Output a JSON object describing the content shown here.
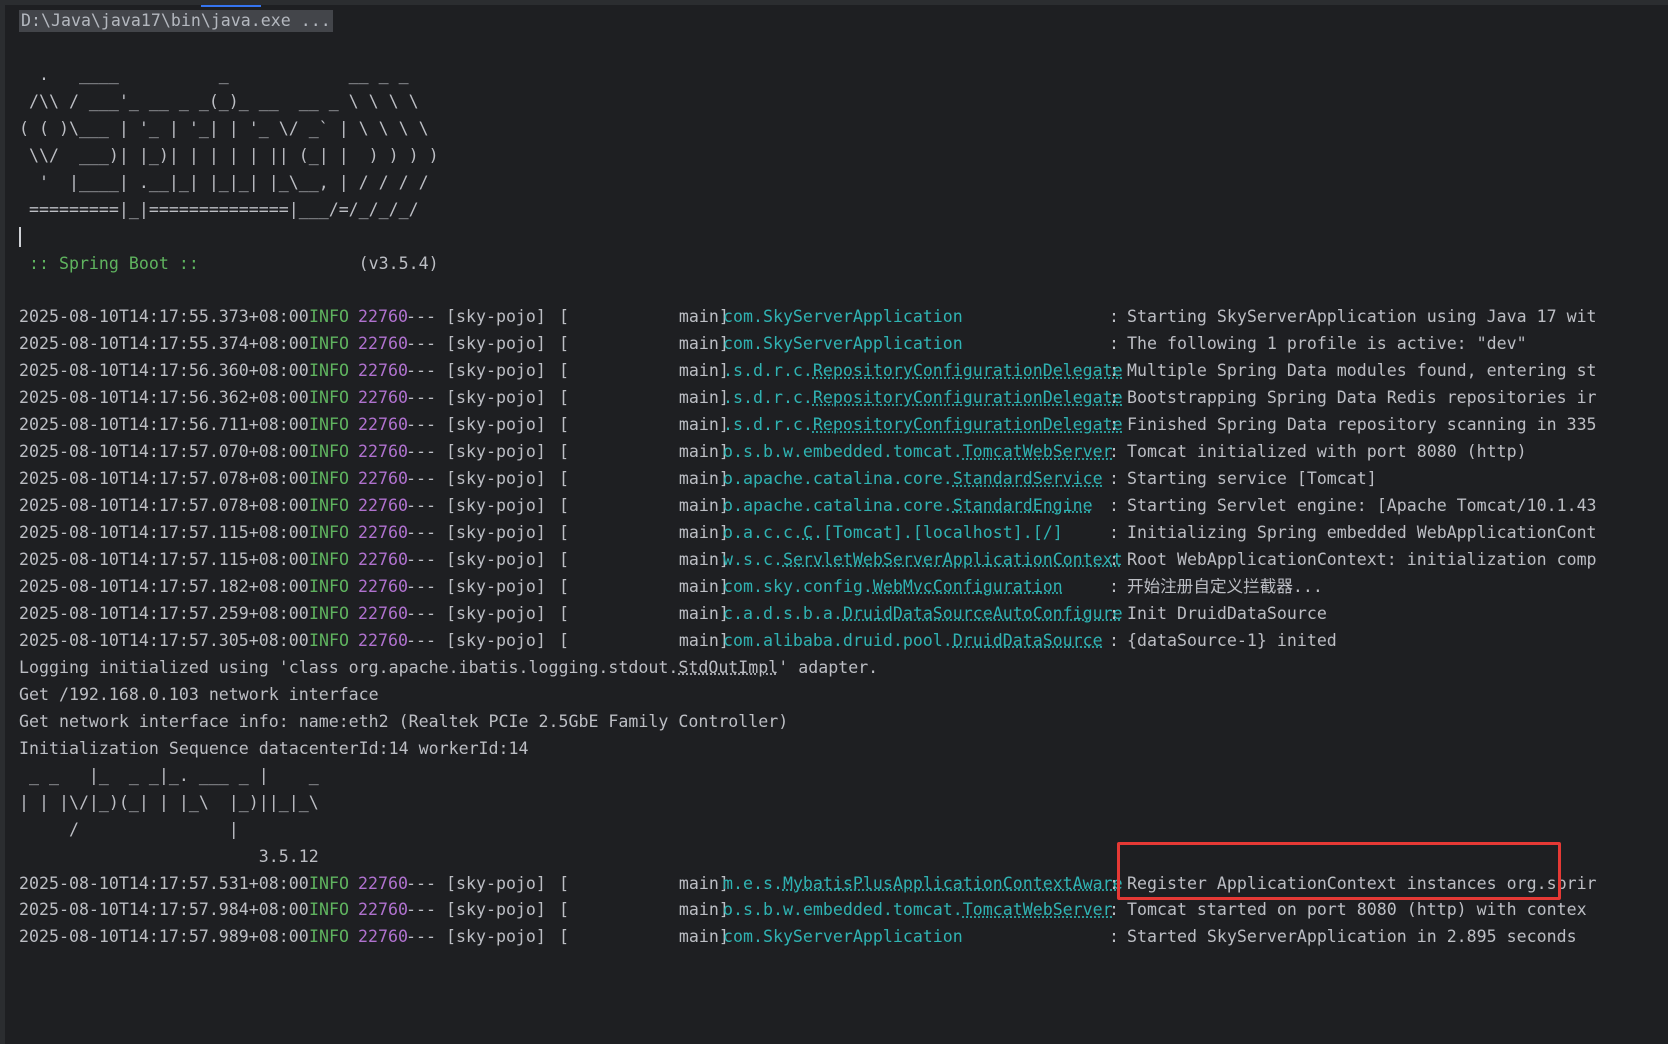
{
  "command_line": "D:\\Java\\java17\\bin\\java.exe ...",
  "banner_lines": [
    "  .   ____          _            __ _ _",
    " /\\\\ / ___'_ __ _ _(_)_ __  __ _ \\ \\ \\ \\",
    "( ( )\\___ | '_ | '_| | '_ \\/ _` | \\ \\ \\ \\",
    " \\\\/  ___)| |_)| | | | | || (_| |  ) ) ) )",
    "  '  |____| .__|_| |_|_| |_\\__, | / / / /",
    " =========|_|==============|___/=/_/_/_/"
  ],
  "spring_boot_label": " :: Spring Boot :: ",
  "spring_boot_version": "               (v3.5.4)",
  "log_entries_1": [
    {
      "ts": "2025-08-10T14:17:55.373+08:00",
      "level": "INFO",
      "pid": "22760",
      "sep": "---",
      "app": "[sky-pojo]",
      "thread": "[           main]",
      "logger_prefix": "com.SkyServerApplication",
      "logger_class": "",
      "message": "Starting SkyServerApplication using Java 17 wit"
    },
    {
      "ts": "2025-08-10T14:17:55.374+08:00",
      "level": "INFO",
      "pid": "22760",
      "sep": "---",
      "app": "[sky-pojo]",
      "thread": "[           main]",
      "logger_prefix": "com.SkyServerApplication",
      "logger_class": "",
      "message": "The following 1 profile is active: \"dev\""
    },
    {
      "ts": "2025-08-10T14:17:56.360+08:00",
      "level": "INFO",
      "pid": "22760",
      "sep": "---",
      "app": "[sky-pojo]",
      "thread": "[           main]",
      "logger_prefix": ".s.d.r.c.",
      "logger_class": "RepositoryConfigurationDelegate",
      "message": "Multiple Spring Data modules found, entering st"
    },
    {
      "ts": "2025-08-10T14:17:56.362+08:00",
      "level": "INFO",
      "pid": "22760",
      "sep": "---",
      "app": "[sky-pojo]",
      "thread": "[           main]",
      "logger_prefix": ".s.d.r.c.",
      "logger_class": "RepositoryConfigurationDelegate",
      "message": "Bootstrapping Spring Data Redis repositories ir"
    },
    {
      "ts": "2025-08-10T14:17:56.711+08:00",
      "level": "INFO",
      "pid": "22760",
      "sep": "---",
      "app": "[sky-pojo]",
      "thread": "[           main]",
      "logger_prefix": ".s.d.r.c.",
      "logger_class": "RepositoryConfigurationDelegate",
      "message": "Finished Spring Data repository scanning in 335"
    },
    {
      "ts": "2025-08-10T14:17:57.070+08:00",
      "level": "INFO",
      "pid": "22760",
      "sep": "---",
      "app": "[sky-pojo]",
      "thread": "[           main]",
      "logger_prefix": "o.s.b.w.embedded.tomcat.",
      "logger_class": "TomcatWebServer",
      "message": "Tomcat initialized with port 8080 (http)"
    },
    {
      "ts": "2025-08-10T14:17:57.078+08:00",
      "level": "INFO",
      "pid": "22760",
      "sep": "---",
      "app": "[sky-pojo]",
      "thread": "[           main]",
      "logger_prefix": "o.apache.catalina.core.",
      "logger_class": "StandardService",
      "message": "Starting service [Tomcat]"
    },
    {
      "ts": "2025-08-10T14:17:57.078+08:00",
      "level": "INFO",
      "pid": "22760",
      "sep": "---",
      "app": "[sky-pojo]",
      "thread": "[           main]",
      "logger_prefix": "o.apache.catalina.core.",
      "logger_class": "StandardEngine",
      "message": "Starting Servlet engine: [Apache Tomcat/10.1.43"
    },
    {
      "ts": "2025-08-10T14:17:57.115+08:00",
      "level": "INFO",
      "pid": "22760",
      "sep": "---",
      "app": "[sky-pojo]",
      "thread": "[           main]",
      "logger_prefix": "o.a.c.c.",
      "logger_class": "C",
      "logger_suffix": ".[Tomcat].[localhost].[/]",
      "message": "Initializing Spring embedded WebApplicationCont"
    },
    {
      "ts": "2025-08-10T14:17:57.115+08:00",
      "level": "INFO",
      "pid": "22760",
      "sep": "---",
      "app": "[sky-pojo]",
      "thread": "[           main]",
      "logger_prefix": "w.s.c.",
      "logger_class": "ServletWebServerApplicationContext",
      "message": "Root WebApplicationContext: initialization comp"
    },
    {
      "ts": "2025-08-10T14:17:57.182+08:00",
      "level": "INFO",
      "pid": "22760",
      "sep": "---",
      "app": "[sky-pojo]",
      "thread": "[           main]",
      "logger_prefix": "com.sky.config.",
      "logger_class": "WebMvcConfiguration",
      "message": "开始注册自定义拦截器..."
    },
    {
      "ts": "2025-08-10T14:17:57.259+08:00",
      "level": "INFO",
      "pid": "22760",
      "sep": "---",
      "app": "[sky-pojo]",
      "thread": "[           main]",
      "logger_prefix": "c.a.d.s.b.a.",
      "logger_class": "DruidDataSourceAutoConfigure",
      "message": "Init DruidDataSource"
    },
    {
      "ts": "2025-08-10T14:17:57.305+08:00",
      "level": "INFO",
      "pid": "22760",
      "sep": "---",
      "app": "[sky-pojo]",
      "thread": "[           main]",
      "logger_prefix": "com.alibaba.druid.pool.",
      "logger_class": "DruidDataSource",
      "message": "{dataSource-1} inited"
    }
  ],
  "logging_line": {
    "before": "Logging initialized using 'class org.apache.ibatis.logging.stdout.",
    "link": "StdOutImpl",
    "after": "' adapter."
  },
  "plain_lines": [
    "Get /192.168.0.103 network interface",
    "Get network interface info: name:eth2 (Realtek PCIe 2.5GbE Family Controller)",
    "Initialization Sequence datacenterId:14 workerId:14"
  ],
  "mybatis_banner": [
    " _ _   |_  _ _|_. ___ _ |    _",
    "| | |\\/|_)(_| | |_\\  |_)||_|_\\",
    "     /               |",
    "                        3.5.12"
  ],
  "log_entries_2": [
    {
      "ts": "2025-08-10T14:17:57.531+08:00",
      "level": "INFO",
      "pid": "22760",
      "sep": "---",
      "app": "[sky-pojo]",
      "thread": "[           main]",
      "logger_prefix": "m.e.s.",
      "logger_class": "MybatisPlusApplicationContextAware",
      "message": "Register ApplicationContext instances org.sprir"
    },
    {
      "ts": "2025-08-10T14:17:57.984+08:00",
      "level": "INFO",
      "pid": "22760",
      "sep": "---",
      "app": "[sky-pojo]",
      "thread": "[           main]",
      "logger_prefix": "o.s.b.w.embedded.tomcat.",
      "logger_class": "TomcatWebServer",
      "message": "Tomcat started on port 8080 (http) with contex"
    },
    {
      "ts": "2025-08-10T14:17:57.989+08:00",
      "level": "INFO",
      "pid": "22760",
      "sep": "---",
      "app": "[sky-pojo]",
      "thread": "[           main]",
      "logger_prefix": "com.SkyServerApplication",
      "logger_class": "",
      "message": "Started SkyServerApplication in 2.895 seconds"
    }
  ],
  "colors": {
    "background": "#1e1f22",
    "text": "#bcbec4",
    "info": "#5fb35f",
    "pid": "#b072cf",
    "logger": "#2fb3b3",
    "highlight_border": "#e53935"
  }
}
